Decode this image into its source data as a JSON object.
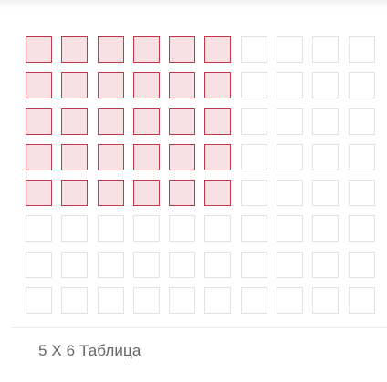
{
  "picker": {
    "label": "5 X 6 Таблица",
    "rows_total": 8,
    "cols_total": 10,
    "selected_rows": 5,
    "selected_cols": 6
  },
  "colors": {
    "selected_border": "#c0394a",
    "selected_fill": "#f8e1e5",
    "cell_border": "#e3e3e3",
    "label_text": "#666666"
  }
}
